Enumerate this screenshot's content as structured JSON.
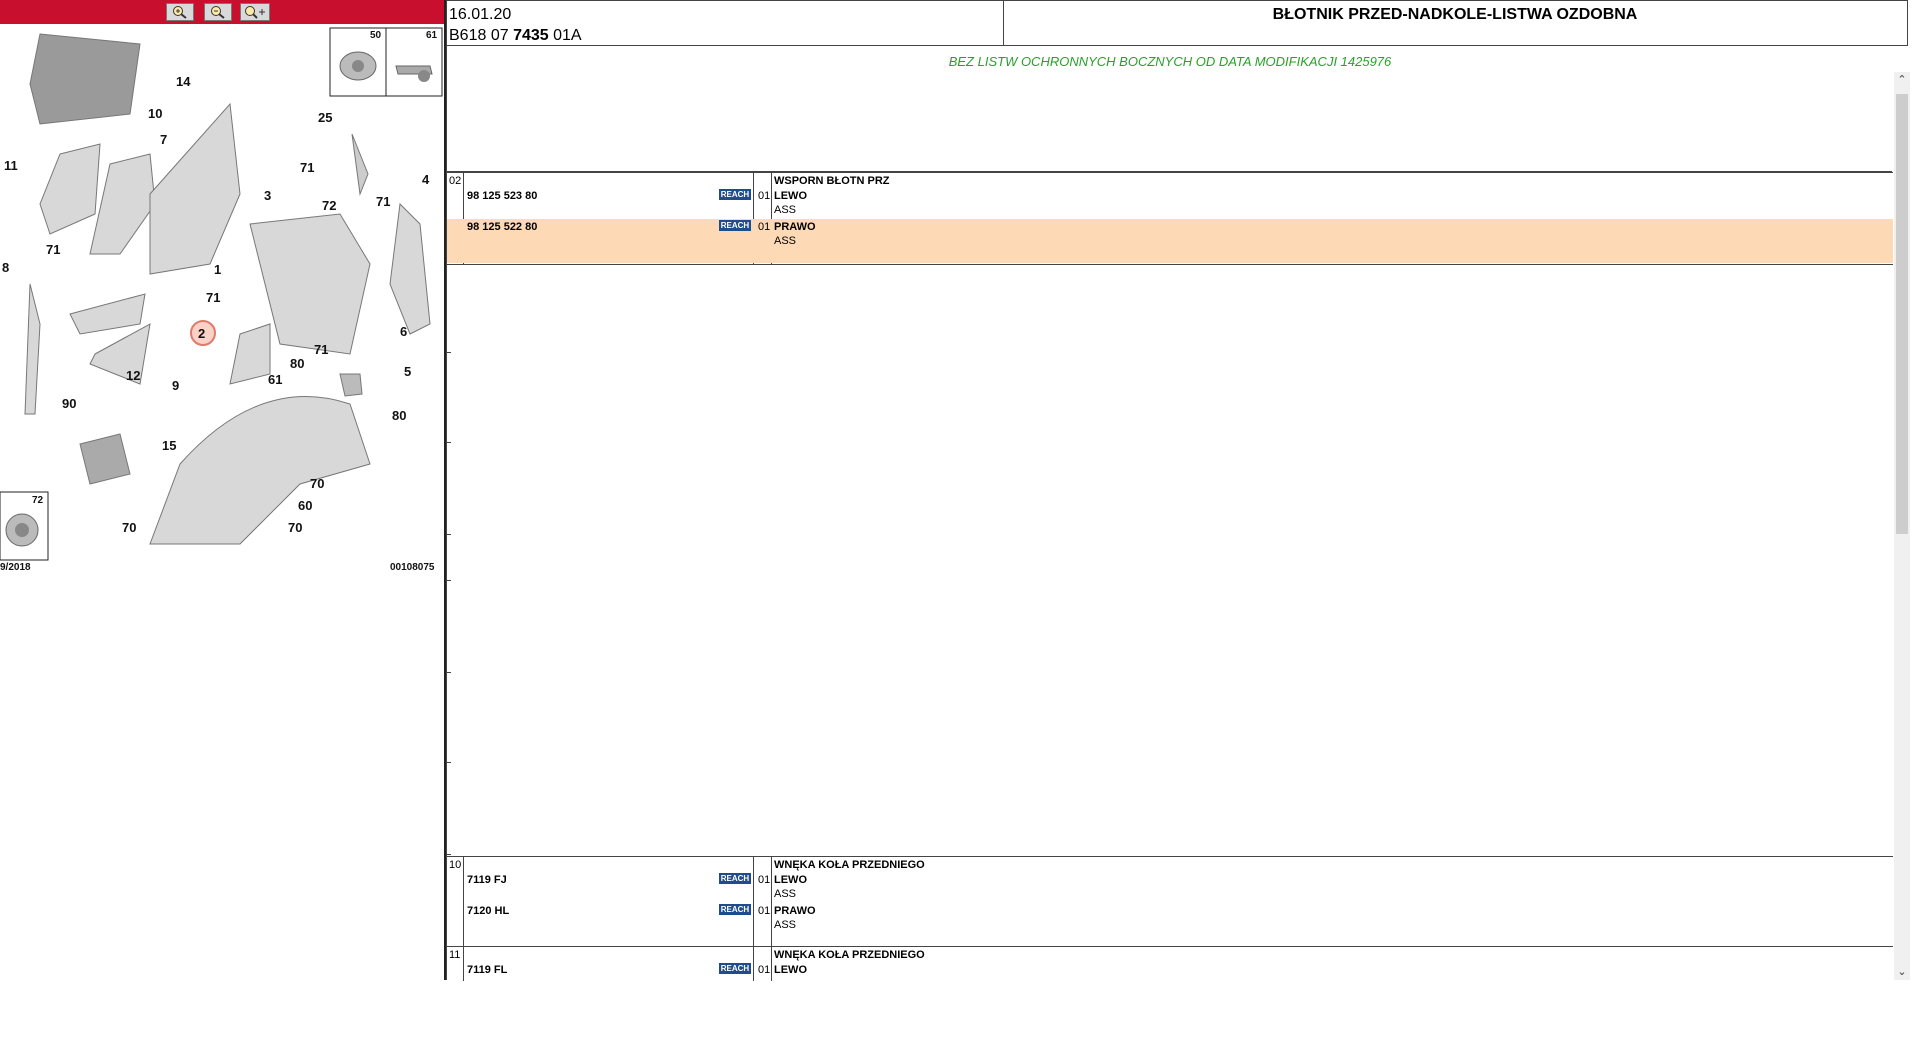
{
  "toolbar": {
    "zoom_in_icon": "zoom-in-icon",
    "zoom_out_icon": "zoom-out-icon",
    "zoom_fit_icon": "zoom-fit-icon"
  },
  "diagram": {
    "callouts": [
      "14",
      "10",
      "7",
      "11",
      "25",
      "71",
      "3",
      "72",
      "71",
      "4",
      "8",
      "71",
      "1",
      "71",
      "6",
      "2",
      "71",
      "12",
      "9",
      "80",
      "61",
      "5",
      "90",
      "15",
      "80",
      "70",
      "60",
      "70",
      "70"
    ],
    "inset_labels": [
      "50",
      "61",
      "72"
    ],
    "footer_left": "9/2018",
    "footer_right": "00108075"
  },
  "header": {
    "date": "16.01.20",
    "code_prefix": "B618 07 ",
    "code_bold": "7435",
    "code_suffix": " 01A",
    "title": "BŁOTNIK PRZED-NADKOLE-LISTWA OZDOBNA"
  },
  "note": "BEZ LISTW OCHRONNYCH BOCZNYCH OD DATA MODIFIKACJI 1425976",
  "groups": [
    {
      "num": "02",
      "name": "WSPORN BŁOTN PRZ",
      "rows": [
        {
          "ref": "98 125 523 80",
          "reach": "REACH",
          "qty": "01",
          "side": "LEWO",
          "sub": "ASS"
        },
        {
          "ref": "98 125 522 80",
          "reach": "REACH",
          "qty": "01",
          "side": "PRAWO",
          "sub": "ASS"
        }
      ]
    },
    {
      "num": "10",
      "name": "WNĘKA KOŁA PRZEDNIEGO",
      "rows": [
        {
          "ref": "7119 FJ",
          "reach": "REACH",
          "qty": "01",
          "side": "LEWO",
          "sub": "ASS"
        },
        {
          "ref": "7120 HL",
          "reach": "REACH",
          "qty": "01",
          "side": "PRAWO",
          "sub": "ASS"
        }
      ]
    },
    {
      "num": "11",
      "name": "WNĘKA KOŁA PRZEDNIEGO",
      "rows": [
        {
          "ref": "7119 FL",
          "reach": "REACH",
          "qty": "01",
          "side": "LEWO",
          "sub": ""
        }
      ]
    }
  ],
  "colors": {
    "toolbar_red": "#c8102e",
    "highlight": "#fdd9b5",
    "note_green": "#2aa02a",
    "reach_blue": "#1f4d8c"
  }
}
